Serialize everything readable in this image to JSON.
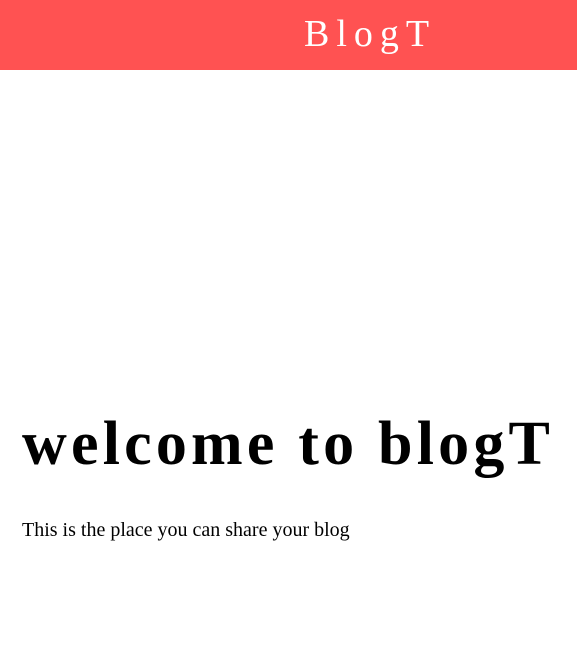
{
  "header": {
    "brand": "BlogT",
    "background_color": "#ff5252"
  },
  "hero": {
    "title": "welcome to blogT",
    "subtitle": "This is the place you can share your blog"
  }
}
